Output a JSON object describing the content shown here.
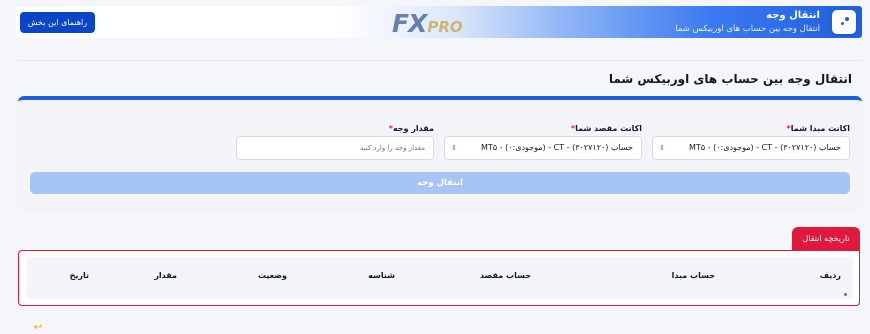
{
  "header": {
    "title": "انتقال وجه",
    "subtitle": "انتقال وجه بین حساب های اوربیکس شما",
    "guide_button": "راهنمای این بخش",
    "logo_main": "FX",
    "logo_suffix": "PRO"
  },
  "page": {
    "title": "انتقال وجه بین حساب های اوربیکس شما"
  },
  "form": {
    "source_label": "اکانت مبدا شما",
    "source_value": "حساب (۳۰۲۷۱۲۰) - CT - (موجودی:۰) - MT۵",
    "dest_label": "اکانت مقصد شما",
    "dest_value": "حساب (۳۰۲۷۱۲۰) - CT - (موجودی:۰) - MT۵",
    "amount_label": "مقدار وجه",
    "amount_placeholder": "مقدار وجه را وارد کنید",
    "required_mark": "*",
    "submit_label": "انتقال وجه"
  },
  "history": {
    "tab_label": "تاریخچه انتقال",
    "columns": [
      "ردیف",
      "حساب مبدا",
      "حساب مقصد",
      "شناسه",
      "وضعیت",
      "مقدار",
      "تاریخ"
    ]
  },
  "colors": {
    "primary": "#1f5fdc",
    "accent_red": "#e0183e",
    "submit_disabled": "#a6c4f5"
  },
  "icons": {
    "banner": "transfer-icon",
    "select_arrow": "chevron-updown-icon"
  }
}
